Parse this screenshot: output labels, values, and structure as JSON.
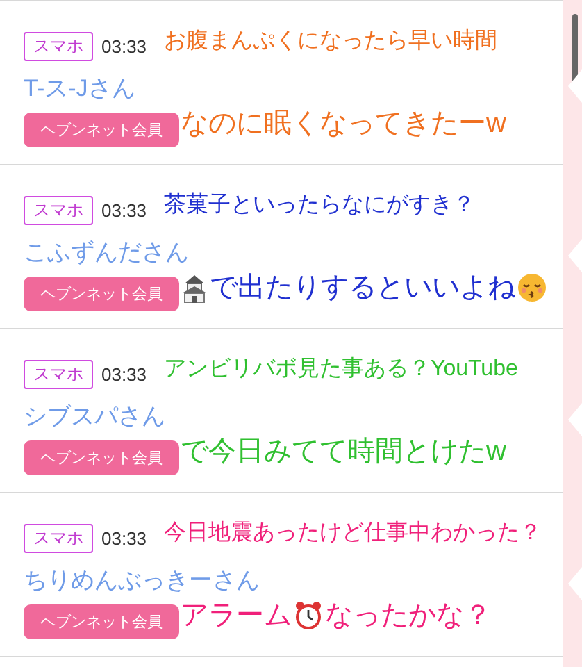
{
  "posts": [
    {
      "device": "スマホ",
      "time": "03:33",
      "name": "T-ス-Jさん",
      "member_button": "ヘブンネット会員",
      "caption": {
        "color": "#f07020",
        "lines": [
          [
            {
              "kind": "text",
              "text": "お腹まんぷくになったら早い時間"
            }
          ],
          [
            {
              "kind": "text",
              "text": "なのに眠くなってきたーw"
            }
          ]
        ]
      }
    },
    {
      "device": "スマホ",
      "time": "03:33",
      "name": "こふずんださん",
      "member_button": "ヘブンネット会員",
      "caption": {
        "color": "#2030d0",
        "lines": [
          [
            {
              "kind": "text",
              "text": "茶菓子といったらなにがすき？"
            }
          ],
          [
            {
              "kind": "castle"
            },
            {
              "kind": "text",
              "text": "で出たりするといいよね"
            },
            {
              "kind": "kiss"
            }
          ]
        ]
      }
    },
    {
      "device": "スマホ",
      "time": "03:33",
      "name": "シブスパさん",
      "member_button": "ヘブンネット会員",
      "caption": {
        "color": "#30c030",
        "lines": [
          [
            {
              "kind": "text",
              "text": "アンビリバボ見た事ある？YouTube"
            }
          ],
          [
            {
              "kind": "text",
              "text": "で今日みてて時間とけたw"
            }
          ]
        ]
      }
    },
    {
      "device": "スマホ",
      "time": "03:33",
      "name": "ちりめんぶっきーさん",
      "member_button": "ヘブンネット会員",
      "caption": {
        "color": "#f0207a",
        "lines": [
          [
            {
              "kind": "text",
              "text": "今日地震あったけど仕事中わかった？"
            }
          ],
          [
            {
              "kind": "text",
              "text": "アラーム"
            },
            {
              "kind": "clock"
            },
            {
              "kind": "text",
              "text": "なったかな？"
            }
          ]
        ]
      }
    }
  ]
}
